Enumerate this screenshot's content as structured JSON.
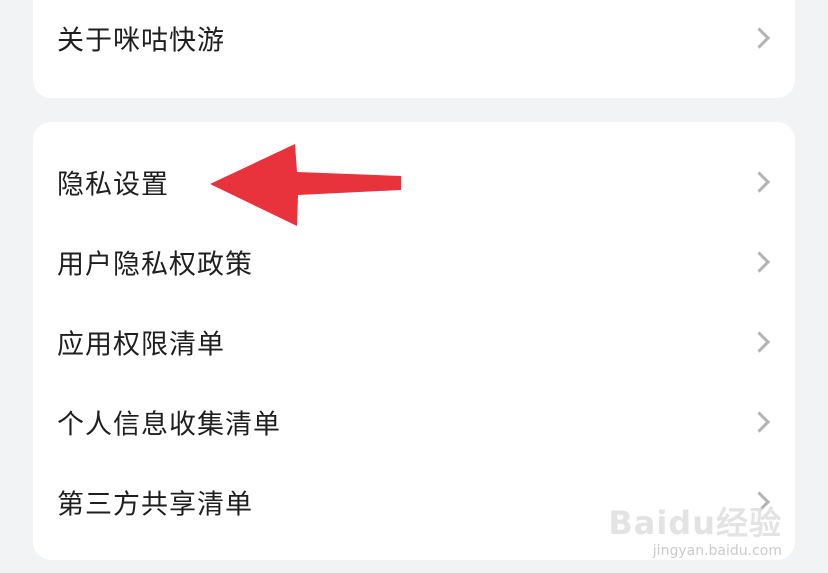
{
  "top_card": {
    "items": [
      {
        "label": "关于咪咕快游"
      }
    ]
  },
  "main_card": {
    "items": [
      {
        "label": "隐私设置"
      },
      {
        "label": "用户隐私权政策"
      },
      {
        "label": "应用权限清单"
      },
      {
        "label": "个人信息收集清单"
      },
      {
        "label": "第三方共享清单"
      }
    ]
  },
  "annotation": {
    "arrow_color": "#e8323c",
    "icon": "red-pointer-arrow-icon"
  },
  "watermark": {
    "brand": "Baidu经验",
    "url": "jingyan.baidu.com"
  }
}
